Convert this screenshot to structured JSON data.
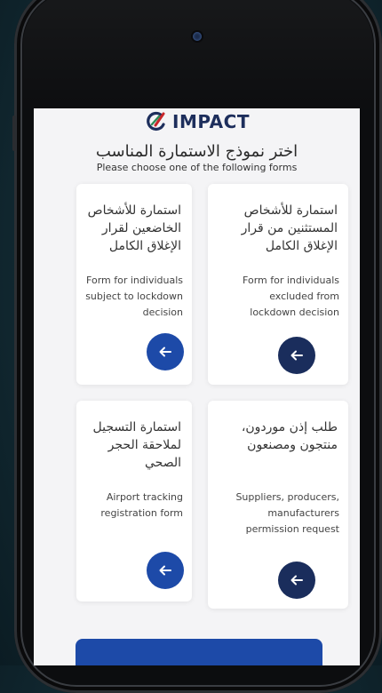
{
  "app": {
    "logo_text": "IMPACT"
  },
  "header": {
    "title_ar": "اختر نموذج الاستمارة المناسب",
    "title_en": "Please choose one of the following forms"
  },
  "cards": [
    {
      "title_ar": "استمارة للأشخاص المستثنين من قرار الإغلاق الكامل",
      "desc_en": "Form for individuals excluded from lockdown decision",
      "button_color": "#1a2d5c"
    },
    {
      "title_ar": "استمارة للأشخاص الخاضعين لقرار الإغلاق الكامل",
      "desc_en": "Form for individuals subject to lockdown decision",
      "button_color": "#1d4aa8"
    },
    {
      "title_ar": "طلب إذن موردون، منتجون ومصنعون",
      "desc_en": "Suppliers, producers, manufacturers permission request",
      "button_color": "#1a2d5c"
    },
    {
      "title_ar": "استمارة التسجيل لملاحقة الحجر الصحي",
      "desc_en": "Airport tracking registration form",
      "button_color": "#1d4aa8"
    }
  ],
  "colors": {
    "navy": "#1a2d5c",
    "blue": "#1d4aa8",
    "logo_red": "#c8262a",
    "logo_green": "#2e8b57"
  },
  "icons": {
    "card_button": "arrow-left-icon"
  }
}
